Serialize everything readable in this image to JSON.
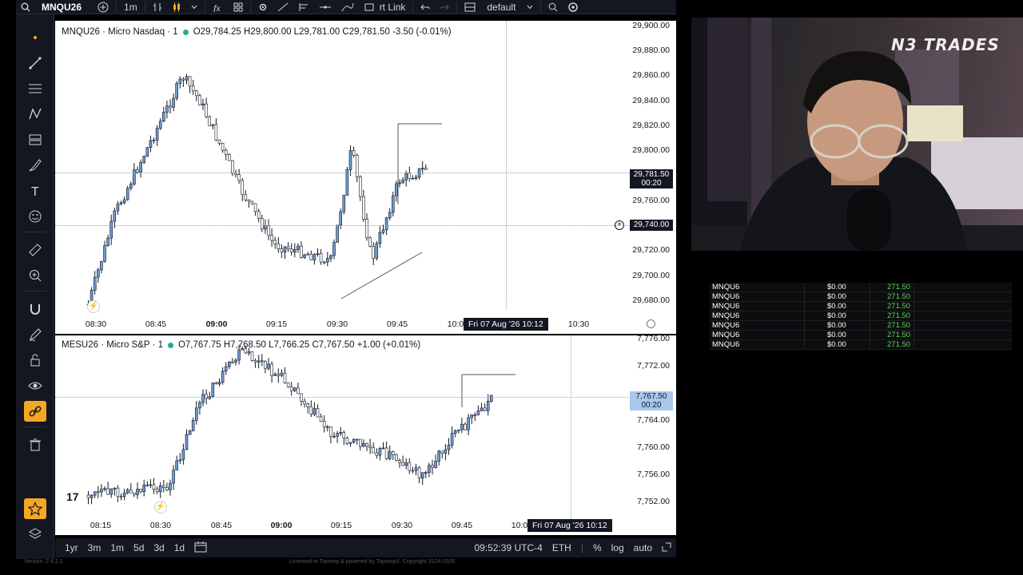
{
  "toolbar": {
    "symbol": "MNQU26",
    "interval": "1m",
    "link_label": "rt Link",
    "layout_name": "default"
  },
  "pane1": {
    "symbol": "MNQU26 · Micro Nasdaq · 1",
    "ohlc": "O29,784.25 H29,800.00 L29,781.00 C29,781.50 -3.50 (-0.01%)",
    "price_axis": [
      "29,900.00",
      "29,880.00",
      "29,860.00",
      "29,840.00",
      "29,820.00",
      "29,800.00",
      "29,760.00",
      "29,720.00",
      "29,700.00",
      "29,680.00"
    ],
    "last_price": "29,781.50",
    "last_price_timer": "00:20",
    "crosshair_price": "29,740.00",
    "time_axis": [
      "08:30",
      "08:45",
      "09:00",
      "09:15",
      "09:30",
      "09:45",
      "10:0",
      "10:30"
    ],
    "crosshair_time": "Fri 07 Aug '26  10:12"
  },
  "pane2": {
    "symbol": "MESU26 · Micro S&P · 1",
    "ohlc": "O7,767.75 H7,768.50 L7,766.25 C7,767.50 +1.00 (+0.01%)",
    "price_axis": [
      "7,776.00",
      "7,772.00",
      "7,764.00",
      "7,760.00",
      "7,756.00",
      "7,752.00"
    ],
    "last_price": "7,767.50",
    "last_price_timer": "00:20",
    "time_axis": [
      "08:15",
      "08:30",
      "08:45",
      "09:00",
      "09:15",
      "09:30",
      "09:45",
      "10:0"
    ],
    "crosshair_time": "Fri 07 Aug '26  10:12"
  },
  "bottombar": {
    "timeframes": [
      "1yr",
      "3m",
      "1m",
      "5d",
      "3d",
      "1d"
    ],
    "clock": "09:52:39 UTC-4",
    "session": "ETH",
    "percent": "%",
    "log": "log",
    "auto": "auto"
  },
  "footer": {
    "version": "Version: 2.4.2.1",
    "license": "Licensed to Topstep & powered by TopstepX. Copyright 2024-2026"
  },
  "webcam": {
    "logo": "N3 TRADES"
  },
  "positions": {
    "rows": [
      {
        "symbol": "MNQU6",
        "pnl": "$0.00",
        "value": "271.50"
      },
      {
        "symbol": "MNQU6",
        "pnl": "$0.00",
        "value": "271.50"
      },
      {
        "symbol": "MNQU6",
        "pnl": "$0.00",
        "value": "271.50"
      },
      {
        "symbol": "MNQU6",
        "pnl": "$0.00",
        "value": "271.50"
      },
      {
        "symbol": "MNQU6",
        "pnl": "$0.00",
        "value": "271.50"
      },
      {
        "symbol": "MNQU6",
        "pnl": "$0.00",
        "value": "271.50"
      },
      {
        "symbol": "MNQU6",
        "pnl": "$0.00",
        "value": "271.50"
      }
    ]
  },
  "colors": {
    "candle_body": "#6b9bd6",
    "candle_wick": "#131722",
    "toolbar_bg": "#131722",
    "accent": "#f5a623",
    "live_dot": "#22ab94",
    "profit": "#5cd35c"
  }
}
